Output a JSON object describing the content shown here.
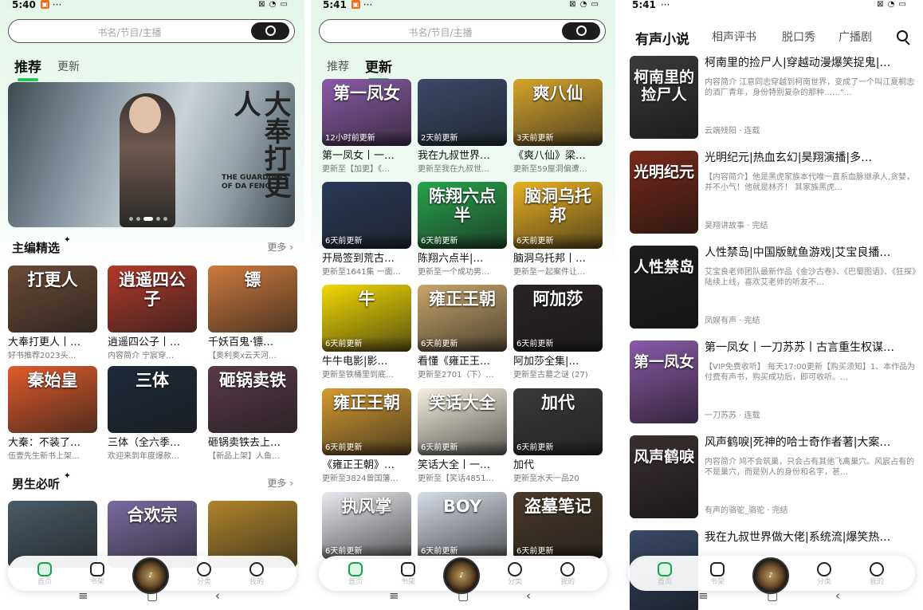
{
  "p1": {
    "time": "5:40",
    "search_ph": "书名/节目/主播",
    "tabs": [
      "推荐",
      "更新"
    ],
    "banner": {
      "cal": "大奉打更人",
      "cal_en": "THE GUARDIANS OF DA FENG"
    },
    "sec1": {
      "title": "主编精选",
      "more": "更多 ›"
    },
    "sec2": {
      "title": "男生必听",
      "more": "更多 ›"
    },
    "cards": [
      {
        "cv": "打更人",
        "title": "大奉打更人丨…",
        "sub": "好书推荐2023头…",
        "color": "#6b4a35"
      },
      {
        "cv": "逍遥四公子",
        "title": "逍遥四公子丨…",
        "sub": "内容简介 宁宸穿…",
        "color": "#b23a2a"
      },
      {
        "cv": "镖",
        "title": "千妖百鬼·镖…",
        "sub": "【奥利奥x云天河…",
        "color": "#cf7a3c"
      },
      {
        "cv": "秦始皇",
        "title": "大秦：不装了…",
        "sub": "伍壹先生新书上架…",
        "color": "#e05a2a"
      },
      {
        "cv": "三体",
        "title": "三体（全六季…",
        "sub": "欢迎来到年度爆款…",
        "color": "#1e2a3a"
      },
      {
        "cv": "砸锅卖铁",
        "title": "砸锅卖铁去上…",
        "sub": "【新品上架】人鱼…",
        "color": "#5a3a4a"
      },
      {
        "cv": "",
        "title": "",
        "sub": "",
        "color": "#4a5a66"
      },
      {
        "cv": "合欢宗",
        "title": "",
        "sub": "",
        "color": "#7a6aa0"
      },
      {
        "cv": "",
        "title": "",
        "sub": "",
        "color": "#b0842a"
      }
    ]
  },
  "p2": {
    "time": "5:41",
    "search_ph": "书名/节目/主播",
    "tabs": [
      "推荐",
      "更新"
    ],
    "cards": [
      {
        "cv": "第一凤女",
        "time": "12小时前更新",
        "title": "第一凤女丨一…",
        "sub": "更新至【加更】《…",
        "color": "#8a5aa8"
      },
      {
        "cv": "",
        "time": "2天前更新",
        "title": "我在九叔世界…",
        "sub": "更新至我在九叔世…",
        "color": "#3a4a6a"
      },
      {
        "cv": "爽八仙",
        "time": "3天前更新",
        "title": "《爽八仙》梁…",
        "sub": "更新至59屋洞偏遭…",
        "color": "#d7a42a"
      },
      {
        "cv": "",
        "time": "6天前更新",
        "title": "开局签到荒古…",
        "sub": "更新至1641集 一面…",
        "color": "#2a3a5a"
      },
      {
        "cv": "陈翔六点半",
        "time": "6天前更新",
        "title": "陈翔六点半|…",
        "sub": "更新至一个成功男…",
        "color": "#26a34a"
      },
      {
        "cv": "脑洞乌托邦",
        "time": "6天前更新",
        "title": "脑洞乌托邦丨…",
        "sub": "更新至一起案件让…",
        "color": "#e8b020"
      },
      {
        "cv": "牛",
        "time": "6天前更新",
        "title": "牛牛电影|影…",
        "sub": "更新至铁桶里到底…",
        "color": "#f2d900"
      },
      {
        "cv": "雍正王朝",
        "time": "6天前更新",
        "title": "看懂《雍正王…",
        "sub": "更新至2701（下）…",
        "color": "#c9a56a"
      },
      {
        "cv": "阿加莎",
        "time": "6天前更新",
        "title": "阿加莎全集|…",
        "sub": "更新至古墓之谜 (27)",
        "color": "#2a2222"
      },
      {
        "cv": "雍正王朝",
        "time": "6天前更新",
        "title": "《雍正王朝》…",
        "sub": "更新至3824曾国藩…",
        "color": "#d49a30"
      },
      {
        "cv": "笑话大全",
        "time": "6天前更新",
        "title": "笑话大全丨一…",
        "sub": "更新至【笑话4851…",
        "color": "#f5f0e0"
      },
      {
        "cv": "加代",
        "time": "6天前更新",
        "title": "加代",
        "sub": "更新至水天一品20",
        "color": "#3a3a3a"
      },
      {
        "cv": "执风掌",
        "time": "6天前更新",
        "title": "",
        "sub": "",
        "color": "#e8eaef"
      },
      {
        "cv": "BOY",
        "time": "6天前更新",
        "title": "",
        "sub": "",
        "color": "#d7dde8"
      },
      {
        "cv": "盗墓笔记",
        "time": "6天前更新",
        "title": "",
        "sub": "",
        "color": "#4a3a2a"
      }
    ]
  },
  "p3": {
    "time": "5:41",
    "tabs": [
      "有声小说",
      "相声评书",
      "脱口秀",
      "广播剧"
    ],
    "books": [
      {
        "cv": "柯南里的捡尸人",
        "title": "柯南里的捡尸人|穿越动漫爆笑捉鬼|…",
        "desc": "内容简介 江意同志穿越到柯南世界，变成了一个叫江夏桐志的酒厂青年，身份特别复杂的那种……\"…",
        "meta": "云端残阳 · 连载",
        "color": "#3a3a3a"
      },
      {
        "cv": "光明纪元",
        "title": "光明纪元|热血玄幻|昊翔演播|多…",
        "desc": "【内容简介】他是黑虎家族本代唯一直系血脉继承人,贪婪，并不小气！他就是林齐！ 其家族黑虎…",
        "meta": "昊翔讲故事 · 完结",
        "color": "#7a2a1a"
      },
      {
        "cv": "人性禁岛",
        "title": "人性禁岛|中国版鱿鱼游戏|艾宝良播…",
        "desc": "艾宝良老师团队最新作品《金沙古卷》、《巴蜀图语》、《狂探》陆续上线，喜欢艾老师的听友不…",
        "meta": "凤娱有声 · 完结",
        "color": "#1e1e1e"
      },
      {
        "cv": "第一凤女",
        "title": "第一凤女丨一刀苏苏丨古言重生权谋…",
        "desc": "【VIP免费收听】 每天17:00更新【购买须知】1、本作品为付费有声书，购买成功后，即可收听。…",
        "meta": "一刀苏苏 · 连载",
        "color": "#8a5aa8"
      },
      {
        "cv": "风声鹤唳",
        "title": "风声鹤唳|死神的哈士奇作者著|大案…",
        "desc": "内容简介 鸠不会筑巢，只会占有其他飞禽巢穴。风宸占有的不是巢穴，而是别人的身份和名字，甚…",
        "meta": "有声的骆驼_骆驼 · 完结",
        "color": "#3a2f2f"
      },
      {
        "cv": "",
        "title": "我在九叔世界做大佬|系统流|爆笑热…",
        "desc": "",
        "meta": "",
        "color": "#3a4a6a"
      }
    ]
  },
  "nav": [
    "首页",
    "书架",
    "",
    "分类",
    "我的"
  ]
}
